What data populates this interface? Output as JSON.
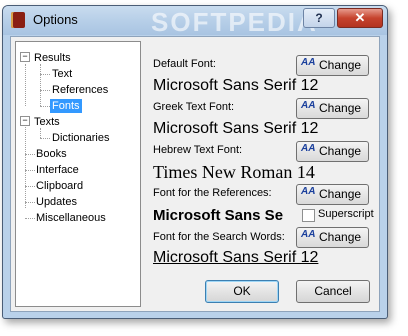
{
  "window": {
    "title": "Options",
    "watermark": "SOFTPEDIA",
    "help_label": "?",
    "close_label": "✕"
  },
  "tree": {
    "results": "Results",
    "text": "Text",
    "references": "References",
    "fonts": "Fonts",
    "texts": "Texts",
    "dictionaries": "Dictionaries",
    "books": "Books",
    "interface": "Interface",
    "clipboard": "Clipboard",
    "updates": "Updates",
    "miscellaneous": "Miscellaneous",
    "expander_minus": "−"
  },
  "fonts": {
    "default_label": "Default Font:",
    "default_sample": "Microsoft Sans Serif 12",
    "greek_label": "Greek Text Font:",
    "greek_sample": "Microsoft Sans Serif 12",
    "hebrew_label": "Hebrew Text Font:",
    "hebrew_sample": "Times New Roman 14",
    "references_label": "Font for the References:",
    "references_sample": "Microsoft Sans Se",
    "superscript_label": "Superscript",
    "search_label": "Font for the Search Words:",
    "search_sample": "Microsoft Sans Serif 12",
    "change_label": "Change",
    "change_icon_text": "AA"
  },
  "buttons": {
    "ok": "OK",
    "cancel": "Cancel"
  }
}
